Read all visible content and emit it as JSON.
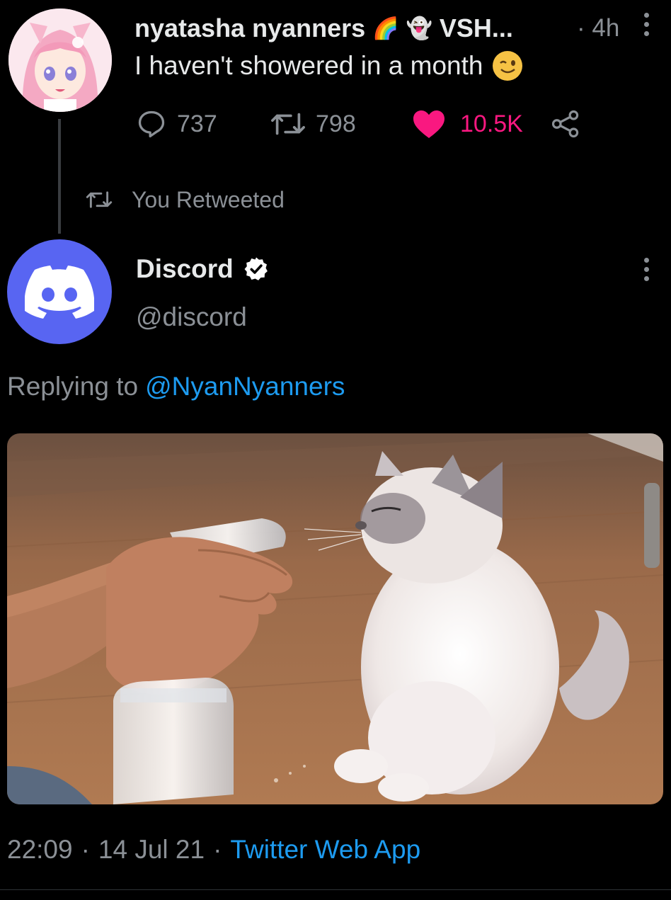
{
  "tweet1": {
    "display_name": "nyatasha nyanners",
    "name_emojis": [
      "🌈",
      "👻"
    ],
    "name_suffix": "VSH...",
    "age": "· 4h",
    "text": "I haven't showered in a month",
    "emoji": "wink-emoji",
    "stats": {
      "replies": "737",
      "retweets": "798",
      "likes": "10.5K"
    },
    "avatar": "anime-pink-hair-avatar"
  },
  "retweet_label": "You Retweeted",
  "tweet2": {
    "display_name": "Discord",
    "verified": true,
    "handle": "@discord",
    "replying_prefix": "Replying to",
    "replying_to": "@NyanNyanners",
    "media": "cat-spray-bottle-photo",
    "time": "22:09",
    "date": "14 Jul 21",
    "source": "Twitter Web App",
    "avatar": "discord-logo-avatar"
  },
  "icons": {
    "reply": "speech-bubble-icon",
    "retweet": "retweet-icon",
    "like": "heart-icon",
    "share": "share-icon",
    "more": "more-vertical-icon",
    "verified": "verified-badge-icon"
  },
  "colors": {
    "background": "#000000",
    "text": "#e7e9ea",
    "muted": "#8b9096",
    "link": "#1d9bf0",
    "like": "#f91880",
    "discord": "#5865f2"
  }
}
